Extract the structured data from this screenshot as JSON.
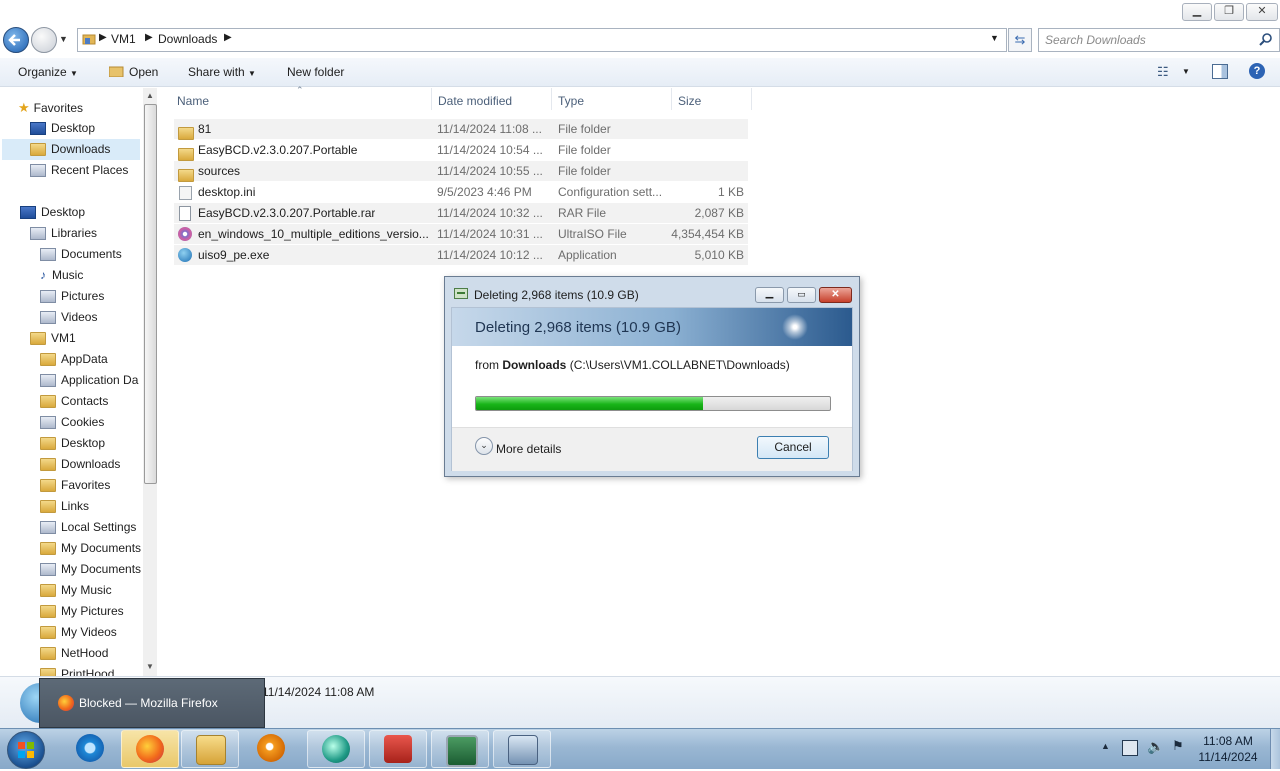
{
  "window": {
    "address": {
      "segments": [
        "VM1",
        "Downloads"
      ]
    },
    "search_placeholder": "Search Downloads"
  },
  "toolbar": {
    "organize": "Organize",
    "open": "Open",
    "share_with": "Share with",
    "new_folder": "New folder"
  },
  "nav": {
    "favorites": "Favorites",
    "favorites_items": [
      "Desktop",
      "Downloads",
      "Recent Places"
    ],
    "desktop": "Desktop",
    "libraries": "Libraries",
    "libraries_items": [
      "Documents",
      "Music",
      "Pictures",
      "Videos"
    ],
    "vm1": "VM1",
    "vm1_items": [
      "AppData",
      "Application Da",
      "Contacts",
      "Cookies",
      "Desktop",
      "Downloads",
      "Favorites",
      "Links",
      "Local Settings",
      "My Documents",
      "My Documents",
      "My Music",
      "My Pictures",
      "My Videos",
      "NetHood",
      "PrintHood"
    ]
  },
  "columns": {
    "name": "Name",
    "date": "Date modified",
    "type": "Type",
    "size": "Size"
  },
  "files": [
    {
      "name": "81",
      "date": "11/14/2024 11:08 ...",
      "type": "File folder",
      "size": "",
      "icon": "folder-icon"
    },
    {
      "name": "EasyBCD.v2.3.0.207.Portable",
      "date": "11/14/2024 10:54 ...",
      "type": "File folder",
      "size": "",
      "icon": "folder-icon"
    },
    {
      "name": "sources",
      "date": "11/14/2024 10:55 ...",
      "type": "File folder",
      "size": "",
      "icon": "folder-icon"
    },
    {
      "name": "desktop.ini",
      "date": "9/5/2023 4:46 PM",
      "type": "Configuration sett...",
      "size": "1 KB",
      "icon": "settings-file-icon"
    },
    {
      "name": "EasyBCD.v2.3.0.207.Portable.rar",
      "date": "11/14/2024 10:32 ...",
      "type": "RAR File",
      "size": "2,087 KB",
      "icon": "file-icon"
    },
    {
      "name": "en_windows_10_multiple_editions_versio...",
      "date": "11/14/2024 10:31 ...",
      "type": "UltraISO File",
      "size": "4,354,454 KB",
      "icon": "disc-icon"
    },
    {
      "name": "uiso9_pe.exe",
      "date": "11/14/2024 10:12 ...",
      "type": "Application",
      "size": "5,010 KB",
      "icon": "app-icon"
    }
  ],
  "dialog": {
    "title": "Deleting 2,968 items (10.9 GB)",
    "heading": "Deleting 2,968 items (10.9 GB)",
    "from_prefix": "from ",
    "from_name": "Downloads",
    "from_path": " (C:\\Users\\VM1.COLLABNET\\Downloads)",
    "progress": 0.64,
    "more_details": "More details",
    "cancel": "Cancel"
  },
  "details": {
    "date": "11/14/2024 11:08 AM"
  },
  "tooltip": {
    "text": "Blocked — Mozilla Firefox"
  },
  "tray": {
    "time": "11:08 AM",
    "date": "11/14/2024"
  },
  "colors": {
    "progress": "#19b519",
    "selection": "#cce8ff",
    "taskbar": "#9ab7d3"
  }
}
